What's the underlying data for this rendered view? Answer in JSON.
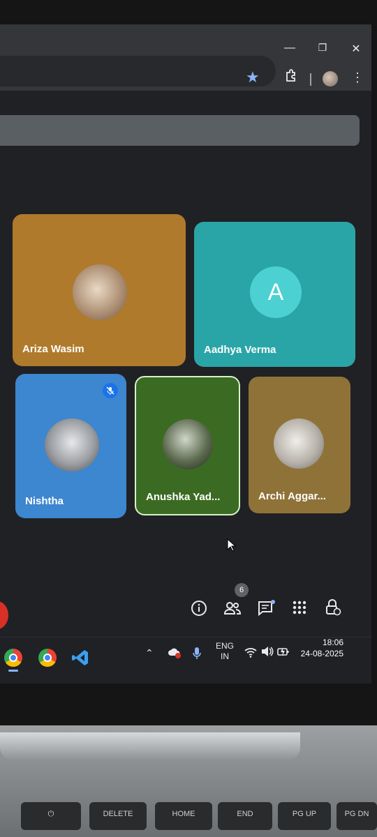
{
  "browser": {
    "window_controls": {
      "minimize": "—",
      "maximize": "❐",
      "close": "✕"
    }
  },
  "meet": {
    "tiles": [
      {
        "name": "Ariza Wasim",
        "color": "#b07a2c",
        "avatar": "photo"
      },
      {
        "name": "Aadhya Verma",
        "color": "#2aa5a7",
        "avatar_letter": "A"
      },
      {
        "name": "Nishtha",
        "color": "#3d86d0",
        "avatar": "photo",
        "muted": true
      },
      {
        "name": "Anushka Yad...",
        "color": "#3b6b22",
        "avatar": "photo",
        "active_speaker": true
      },
      {
        "name": "Archi Aggar...",
        "color": "#8e7238",
        "avatar": "photo"
      }
    ],
    "participants_count": "6",
    "controls": [
      "info-icon",
      "people-icon",
      "chat-icon",
      "activities-icon",
      "host-controls-icon"
    ]
  },
  "taskbar": {
    "language": "ENG",
    "region": "IN",
    "time": "18:06",
    "date": "24-08-2025"
  },
  "keyboard": {
    "keys": [
      "DELETE",
      "HOME",
      "END",
      "PG UP",
      "PG DN"
    ]
  }
}
